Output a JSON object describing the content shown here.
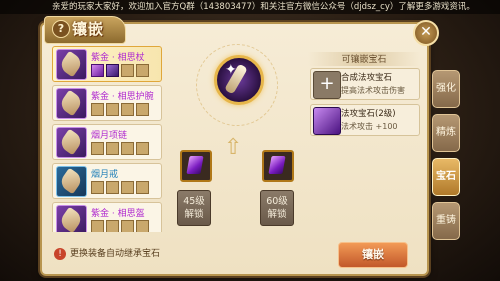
{
  "notice": "亲爱的玩家大家好，欢迎加入官方Q群（143803477）和关注官方微信公众号（djdsz_cy）了解更多游戏资讯。",
  "window": {
    "title": "镶嵌",
    "help_label": "?",
    "close_label": "✕"
  },
  "equipment": [
    {
      "name": "紫金 · 相思杖",
      "quality": "purple",
      "slots": [
        "gem",
        "gem2",
        "empty",
        "empty"
      ]
    },
    {
      "name": "紫金 · 相思护腕",
      "quality": "purple",
      "slots": [
        "empty",
        "empty",
        "empty",
        "empty"
      ]
    },
    {
      "name": "烟月项链",
      "quality": "purple",
      "slots": [
        "empty",
        "empty",
        "empty",
        "empty"
      ]
    },
    {
      "name": "烟月戒",
      "quality": "blue",
      "slots": [
        "empty",
        "empty",
        "empty",
        "empty"
      ]
    },
    {
      "name": "紫金 · 相思盔",
      "quality": "purple",
      "slots": [
        "empty",
        "empty",
        "empty",
        "empty"
      ]
    }
  ],
  "center": {
    "socket_1_locked": {
      "line1": "45级",
      "line2": "解锁"
    },
    "socket_2_locked": {
      "line1": "60级",
      "line2": "解锁"
    }
  },
  "gem_panel": {
    "header": "可镶嵌宝石",
    "items": [
      {
        "name": "合成法攻宝石",
        "desc": "提高法术攻击伤害"
      },
      {
        "name": "法攻宝石(2级)",
        "desc": "法术攻击 +100"
      }
    ]
  },
  "tabs": [
    {
      "label": "强化",
      "active": false
    },
    {
      "label": "精炼",
      "active": false
    },
    {
      "label": "宝石",
      "active": true
    },
    {
      "label": "重铸",
      "active": false
    }
  ],
  "footer": {
    "hint": "更换装备自动继承宝石",
    "hint_icon": "!",
    "action_button": "镶嵌"
  },
  "colors": {
    "accent": "#e8b966",
    "purple_quality": "#b02bd0",
    "blue_quality": "#1f7fb8"
  }
}
